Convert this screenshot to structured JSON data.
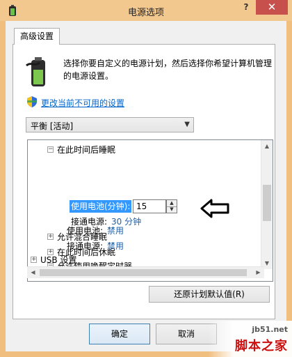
{
  "window": {
    "title": "电源选项",
    "help_label": "?",
    "close_label": "✕"
  },
  "tab": {
    "label": "高级设置"
  },
  "description": "选择你要自定义的电源计划，然后选择你希望计算机管理的电源设置。",
  "change_link": "更改当前不可用的设置",
  "plan_select": {
    "value": "平衡 [活动]"
  },
  "tree": {
    "nodes": [
      {
        "expander": "⊟",
        "label": "在此时间后睡眠"
      },
      {
        "label": "使用电池(分钟):",
        "input_value": "15"
      },
      {
        "label": "接通电源:",
        "value": "30 分钟"
      },
      {
        "expander": "⊞",
        "label": "允许混合睡眠"
      },
      {
        "expander": "⊞",
        "label": "在此时间后休眠"
      },
      {
        "expander": "⊟",
        "label": "允许使用唤醒定时器"
      },
      {
        "label": "使用电池:",
        "value": "禁用"
      },
      {
        "label": "接通电源:",
        "value": "禁用"
      },
      {
        "expander": "⊞",
        "label": "USB 设置"
      }
    ]
  },
  "buttons": {
    "restore": "还原计划默认值(R)",
    "ok": "确定",
    "cancel": "取消"
  },
  "watermark": {
    "url": "jb51.net",
    "name": "脚本之家"
  },
  "colors": {
    "accent": "#3399ff",
    "link": "#0066cc",
    "value": "#1f5fa8",
    "titlebar": "#f3c88f",
    "close": "#c7504c"
  },
  "icons": [
    "battery-plan-icon",
    "uac-shield-icon",
    "pointer-arrow-icon"
  ]
}
